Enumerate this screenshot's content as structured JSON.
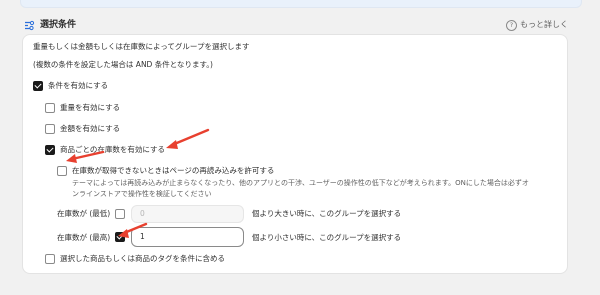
{
  "header": {
    "title": "選択条件",
    "help_link": "もっと詳しく"
  },
  "card": {
    "description": "重量もしくは金額もしくは在庫数によってグループを選択します",
    "note": "(複数の条件を設定した場合は AND 条件となります。)",
    "enable_conditions": {
      "label": "条件を有効にする",
      "checked": true
    },
    "weight": {
      "label": "重量を有効にする",
      "checked": false
    },
    "amount": {
      "label": "金額を有効にする",
      "checked": false
    },
    "per_product_stock": {
      "label": "商品ごとの在庫数を有効にする",
      "checked": true
    },
    "allow_reload": {
      "label": "在庫数が取得できないときはページの再読み込みを許可する",
      "checked": false,
      "help_line1": "テーマによっては再読み込みが止まらなくなったり、他のアプリとの干渉、ユーザーの操作性の低下などが考えられます。ONにした場合は必ずオ",
      "help_line2": "ンラインストアで操作性を検証してください"
    },
    "stock_min": {
      "label": "在庫数が (最低)",
      "checked": false,
      "value": "0",
      "suffix": "個より大きい時に、このグループを選択する"
    },
    "stock_max": {
      "label": "在庫数が (最高)",
      "checked": true,
      "value": "1",
      "suffix": "個より小さい時に、このグループを選択する"
    },
    "tags": {
      "label": "選択した商品もしくは商品のタグを条件に含める",
      "checked": false
    }
  },
  "colors": {
    "annotation_arrow": "#e8402f",
    "checkbox_checked": "#1a1a1a"
  }
}
